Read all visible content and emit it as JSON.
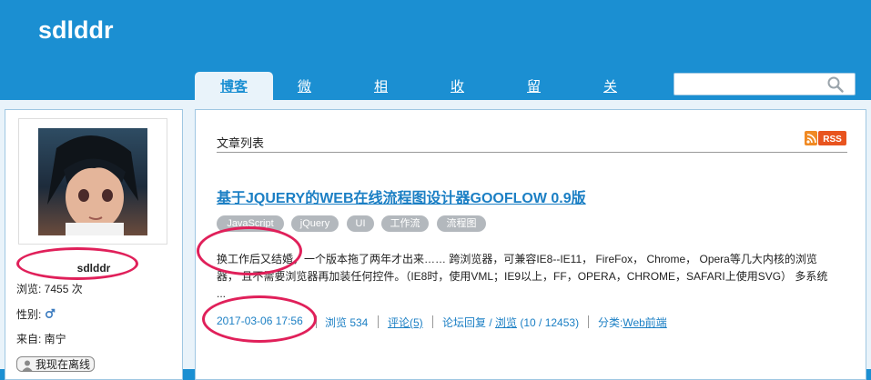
{
  "site": {
    "title": "sdlddr"
  },
  "nav": {
    "tabs": [
      {
        "label": "博客",
        "active": true
      },
      {
        "label": "微博"
      },
      {
        "label": "相册"
      },
      {
        "label": "收藏"
      },
      {
        "label": "留言"
      },
      {
        "label": "关于我"
      }
    ]
  },
  "search": {
    "placeholder": ""
  },
  "sidebar": {
    "username": "sdlddr",
    "views_label": "浏览: 7455 次",
    "gender_label": "性别:",
    "gender_icon": "male-icon",
    "from_label": "来自: 南宁",
    "offline_button": "我现在离线"
  },
  "main": {
    "list_title": "文章列表",
    "rss_label": "RSS",
    "post": {
      "title": "基于JQUERY的WEB在线流程图设计器GOOFLOW 0.9版",
      "tags": [
        "JavaScript",
        "jQuery",
        "UI",
        "工作流",
        "流程图"
      ],
      "excerpt_line1": "换工作后又结婚，一个版本拖了两年才出来…… 跨浏览器，可兼容IE8--IE11， FireFox， Chrome， Opera等几大内核的浏览",
      "excerpt_line2": "器， 且不需要浏览器再加装任何控件。（IE8时，使用VML；IE9以上，FF，OPERA，CHROME，SAFARI上使用SVG） 多系统",
      "excerpt_line3": "...",
      "date": "2017-03-06 17:56",
      "views": "浏览 534",
      "comments": "评论(5)",
      "forum_prefix": "论坛回复 / ",
      "forum_link": "浏览",
      "forum_counts": " (10 / 12453)",
      "category_prefix": "分类:",
      "category_link": "Web前端"
    }
  }
}
